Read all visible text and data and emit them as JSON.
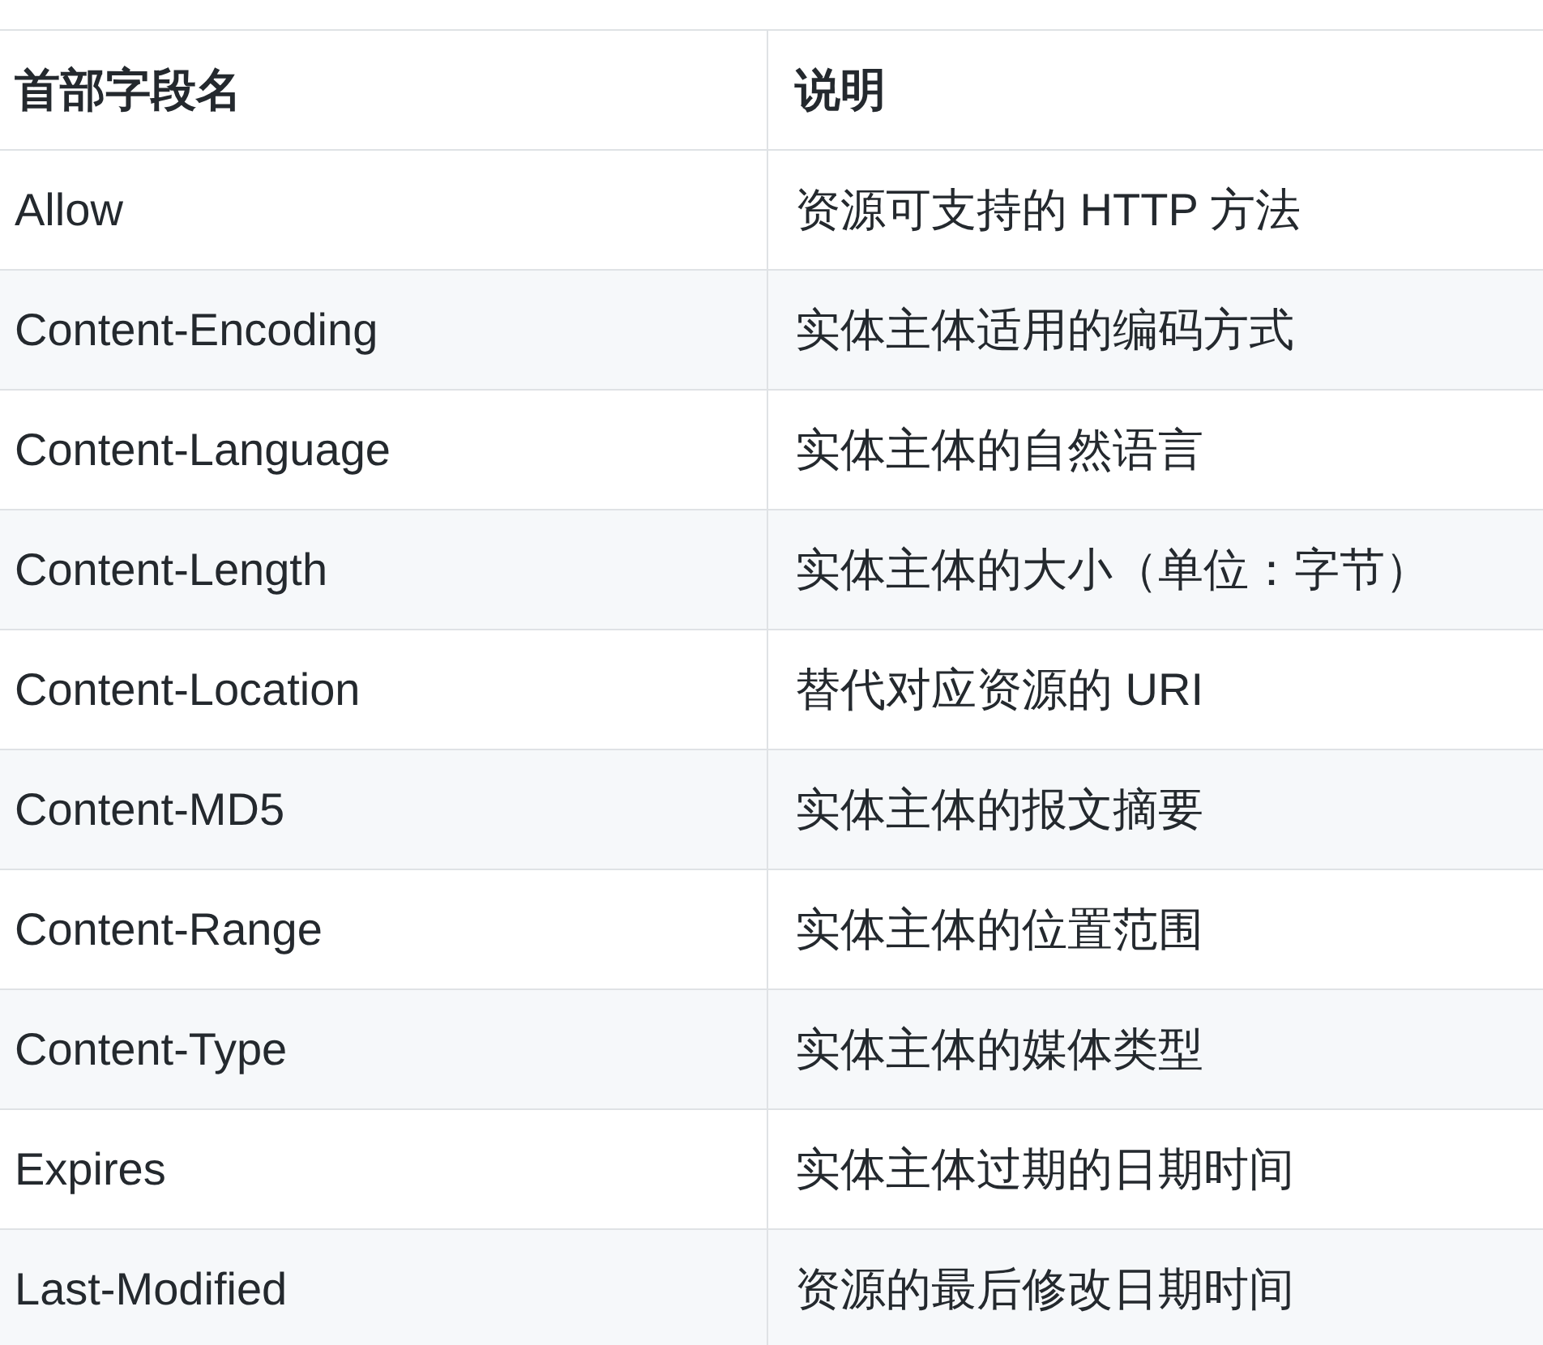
{
  "table": {
    "columns": [
      "首部字段名",
      "说明"
    ],
    "rows": [
      [
        "Allow",
        "资源可支持的 HTTP 方法"
      ],
      [
        "Content-Encoding",
        "实体主体适用的编码方式"
      ],
      [
        "Content-Language",
        "实体主体的自然语言"
      ],
      [
        "Content-Length",
        "实体主体的大小（单位：字节）"
      ],
      [
        "Content-Location",
        "替代对应资源的 URI"
      ],
      [
        "Content-MD5",
        "实体主体的报文摘要"
      ],
      [
        "Content-Range",
        "实体主体的位置范围"
      ],
      [
        "Content-Type",
        "实体主体的媒体类型"
      ],
      [
        "Expires",
        "实体主体过期的日期时间"
      ],
      [
        "Last-Modified",
        "资源的最后修改日期时间"
      ]
    ]
  }
}
